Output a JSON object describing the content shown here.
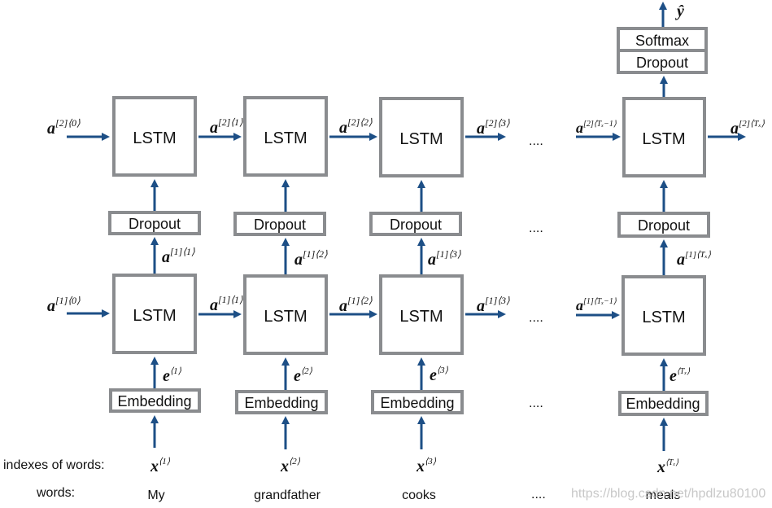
{
  "diagram": {
    "title": "",
    "layers": {
      "lstm_label": "LSTM",
      "dropout_label": "Dropout",
      "embedding_label": "Embedding",
      "softmax_label": "Softmax"
    },
    "columns": [
      {
        "a2_in": {
          "base": "a",
          "sup": "[2]⟨0⟩"
        },
        "a2_out": {
          "base": "a",
          "sup": "[2]⟨1⟩"
        },
        "a1_in": {
          "base": "a",
          "sup": "[1]⟨0⟩"
        },
        "a1_out": {
          "base": "a",
          "sup": "[1]⟨1⟩"
        },
        "a1_up": {
          "base": "a",
          "sup": "[1]⟨1⟩"
        },
        "e": {
          "base": "e",
          "sup": "⟨1⟩"
        },
        "x": {
          "base": "x",
          "sup": "⟨1⟩"
        },
        "word": "My"
      },
      {
        "a2_out": {
          "base": "a",
          "sup": "[2]⟨2⟩"
        },
        "a1_out": {
          "base": "a",
          "sup": "[1]⟨2⟩"
        },
        "a1_up": {
          "base": "a",
          "sup": "[1]⟨2⟩"
        },
        "e": {
          "base": "e",
          "sup": "⟨2⟩"
        },
        "x": {
          "base": "x",
          "sup": "⟨2⟩"
        },
        "word": "grandfather"
      },
      {
        "a2_out": {
          "base": "a",
          "sup": "[2]⟨3⟩"
        },
        "a1_out": {
          "base": "a",
          "sup": "[1]⟨3⟩"
        },
        "a1_up": {
          "base": "a",
          "sup": "[1]⟨3⟩"
        },
        "e": {
          "base": "e",
          "sup": "⟨3⟩"
        },
        "x": {
          "base": "x",
          "sup": "⟨3⟩"
        },
        "word": "cooks"
      },
      {
        "a2_in": {
          "base": "a",
          "sup": "[2]⟨Tₓ−1⟩"
        },
        "a2_out": {
          "base": "a",
          "sup": "[2]⟨Tₓ⟩"
        },
        "a1_in": {
          "base": "a",
          "sup": "[1]⟨Tₓ−1⟩"
        },
        "a1_up": {
          "base": "a",
          "sup": "[1]⟨Tₓ⟩"
        },
        "e": {
          "base": "e",
          "sup": "⟨Tₓ⟩"
        },
        "x": {
          "base": "x",
          "sup": "⟨Tₓ⟩"
        },
        "word": "meals"
      }
    ],
    "output": {
      "base": "ŷ"
    },
    "ellipsis": "....",
    "row_labels": {
      "indexes": "indexes of words:",
      "words": "words:"
    },
    "watermark": "https://blog.csdn.net/hpdlzu80100",
    "colors": {
      "arrow": "#1d4f86",
      "box_border": "#8a8c8f"
    }
  }
}
